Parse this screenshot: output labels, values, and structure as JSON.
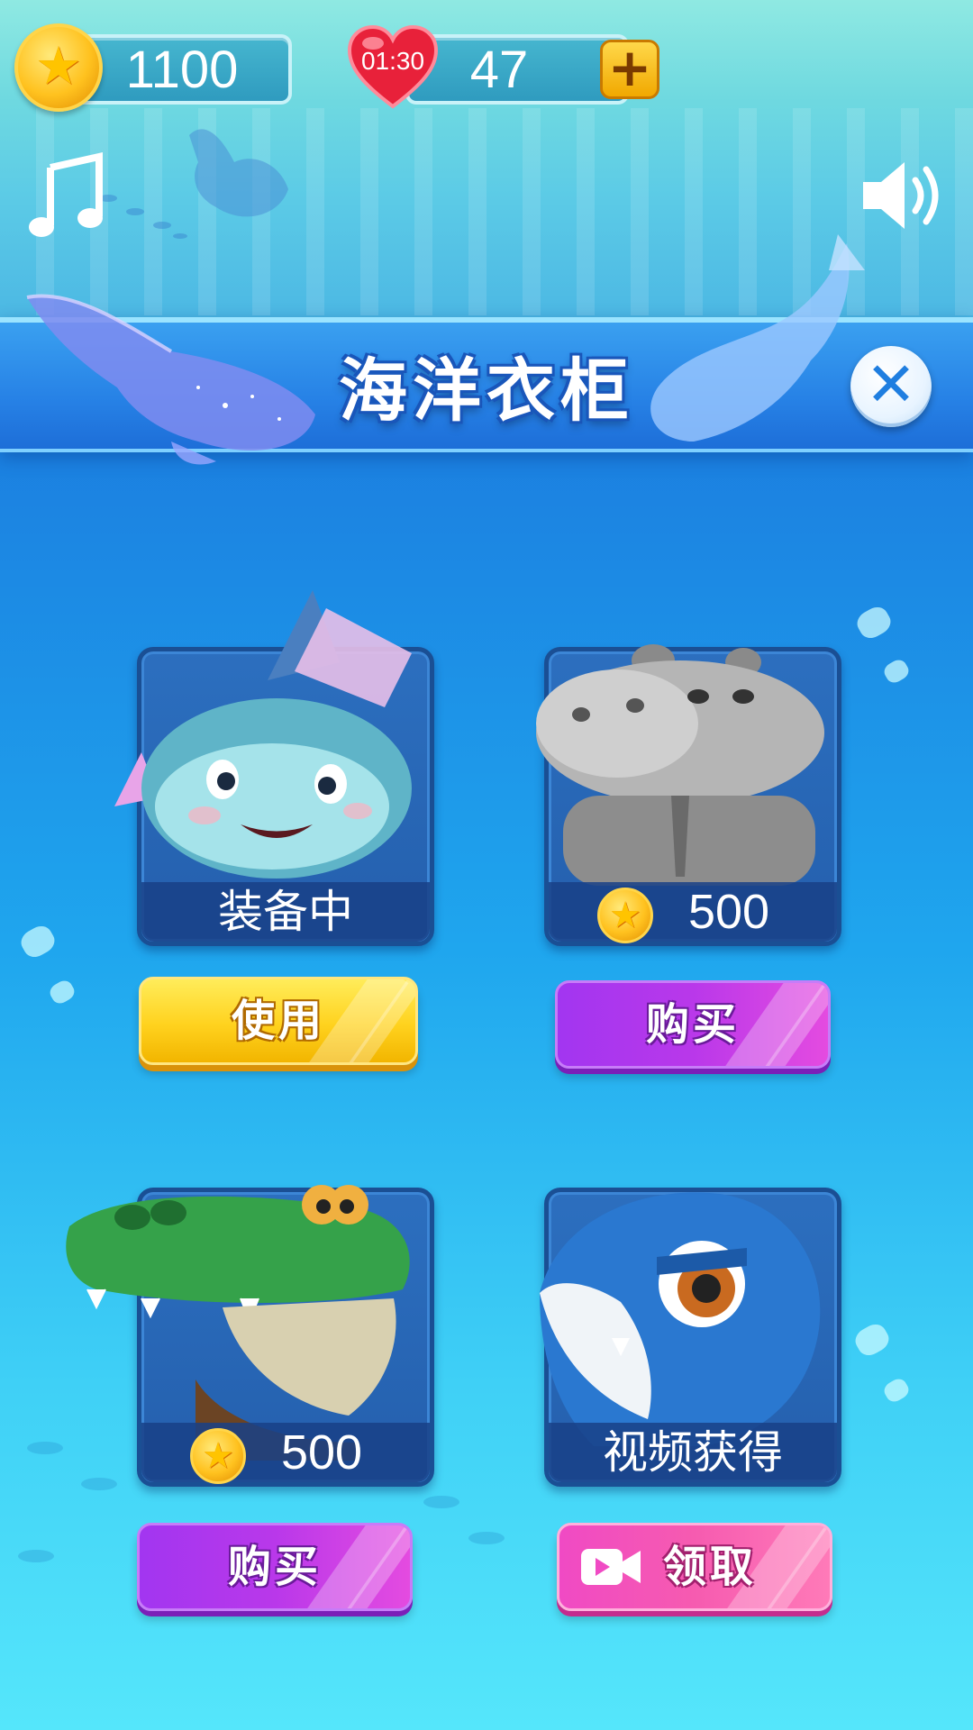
{
  "hud": {
    "coins": "1100",
    "lives_timer": "01:30",
    "lives": "47",
    "add_icon": "plus-icon",
    "coin_icon": "coin-star-icon",
    "heart_icon": "heart-icon"
  },
  "toolbar": {
    "music_icon": "music-note-icon",
    "sound_icon": "speaker-icon"
  },
  "panel": {
    "title": "海洋衣柜",
    "close_icon": "close-icon"
  },
  "skins": [
    {
      "creature": "blue-fish",
      "status_label": "装备中",
      "price": "",
      "button_label": "使用",
      "button_style": "yellow"
    },
    {
      "creature": "hippo",
      "status_label": "",
      "price": "500",
      "button_label": "购买",
      "button_style": "purple"
    },
    {
      "creature": "crocodile",
      "status_label": "",
      "price": "500",
      "button_label": "购买",
      "button_style": "purple"
    },
    {
      "creature": "shark",
      "status_label": "视频获得",
      "price": "",
      "button_label": "领取",
      "button_style": "pink",
      "button_icon": "video-camera-icon"
    }
  ],
  "colors": {
    "accent_yellow": "#ffd21e",
    "accent_purple": "#b938ea",
    "accent_pink": "#f65bb0",
    "panel_blue": "#2782e6",
    "coin_gold": "#ffc21f"
  }
}
